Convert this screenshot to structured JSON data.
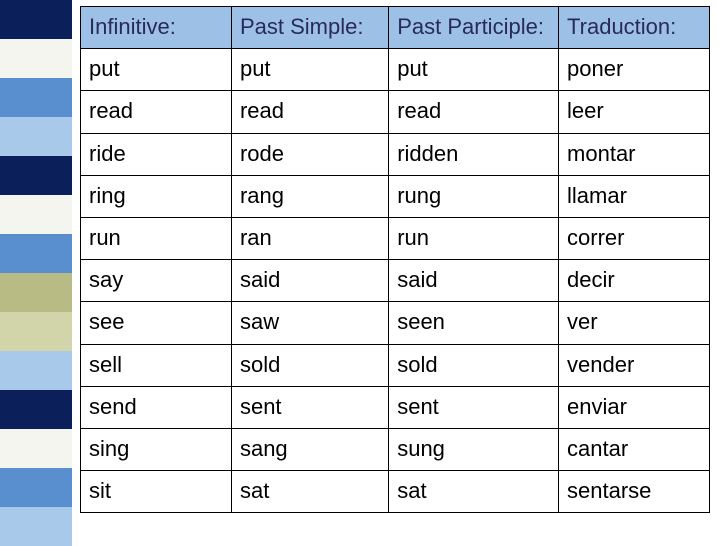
{
  "table": {
    "headers": {
      "infinitive": "Infinitive:",
      "past_simple": "Past Simple:",
      "past_participle": "Past Participle:",
      "traduction": "Traduction:"
    },
    "rows": [
      {
        "infinitive": "put",
        "past_simple": "put",
        "past_participle": "put",
        "traduction": "poner"
      },
      {
        "infinitive": "read",
        "past_simple": "read",
        "past_participle": "read",
        "traduction": "leer"
      },
      {
        "infinitive": "ride",
        "past_simple": "rode",
        "past_participle": "ridden",
        "traduction": "montar"
      },
      {
        "infinitive": "ring",
        "past_simple": "rang",
        "past_participle": "rung",
        "traduction": "llamar"
      },
      {
        "infinitive": "run",
        "past_simple": "ran",
        "past_participle": "run",
        "traduction": "correr"
      },
      {
        "infinitive": "say",
        "past_simple": "said",
        "past_participle": "said",
        "traduction": "decir"
      },
      {
        "infinitive": "see",
        "past_simple": "saw",
        "past_participle": "seen",
        "traduction": "ver"
      },
      {
        "infinitive": "sell",
        "past_simple": "sold",
        "past_participle": "sold",
        "traduction": "vender"
      },
      {
        "infinitive": "send",
        "past_simple": "sent",
        "past_participle": "sent",
        "traduction": "enviar"
      },
      {
        "infinitive": "sing",
        "past_simple": "sang",
        "past_participle": "sung",
        "traduction": "cantar"
      },
      {
        "infinitive": "sit",
        "past_simple": "sat",
        "past_participle": "sat",
        "traduction": "sentarse"
      }
    ]
  }
}
